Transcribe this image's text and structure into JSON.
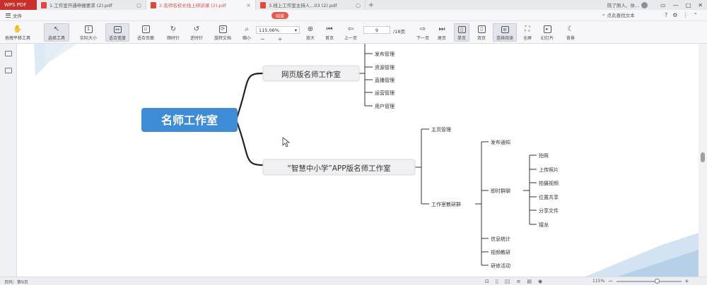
{
  "titlebar": {
    "app_name": "WPS PDF",
    "tabs": [
      {
        "label": "1.工作室开通申报要求 (2).pdf",
        "active": false
      },
      {
        "label": "2.名师名校长线上研训课 (2).pdf",
        "active": true
      },
      {
        "label": "3.线上工作室主持人...03 (2).pdf",
        "active": false
      }
    ],
    "new_tab": "+",
    "user_name": "陈了照人、休..."
  },
  "menu": {
    "file": "文件",
    "reading_badge": "阅读",
    "find_placeholder": "点此查找文本"
  },
  "toolbar": {
    "items": [
      {
        "label": "拖拽平移工具",
        "icon": "hand-icon"
      },
      {
        "label": "选择工具",
        "icon": "cursor-icon"
      },
      {
        "label": "实际大小",
        "icon": "actual-size-icon"
      },
      {
        "label": "适合宽度",
        "icon": "fit-width-icon"
      },
      {
        "label": "适合页面",
        "icon": "fit-page-icon"
      },
      {
        "label": "顺时针",
        "icon": "rotate-cw-icon"
      },
      {
        "label": "逆时针",
        "icon": "rotate-ccw-icon"
      },
      {
        "label": "旋转文档",
        "icon": "rotate-doc-icon"
      },
      {
        "label": "缩小",
        "icon": "zoom-out-icon"
      }
    ],
    "zoom_value": "115.06%",
    "zoom_in_label": "放大",
    "first_page": "首页",
    "prev_page": "上一页",
    "page_current": "9",
    "page_total": "/18页",
    "next_page": "下一页",
    "last_page": "尾页",
    "single_page": "单页",
    "double_page": "双页",
    "continuous": "连续阅读",
    "fullscreen": "全屏",
    "slideshow": "幻灯片",
    "background": "背景"
  },
  "mindmap": {
    "root": "名师工作室",
    "web_branch": "网页版名师工作室",
    "web_items": [
      "发布管理",
      "资源管理",
      "直播管理",
      "运营管理",
      "用户管理"
    ],
    "app_branch": "“智慧中小学”APP版名师工作室",
    "app_items": [
      "主页管理",
      "工作室教研群"
    ],
    "group_items": [
      "发布通知",
      "即时群聊",
      "信息统计",
      "视频教研",
      "研修活动"
    ],
    "chat_items": [
      "拍照",
      "上传照片",
      "拍摄视频",
      "位置共享",
      "分享文件",
      "接龙"
    ]
  },
  "status": {
    "page_info": "页码：第9页",
    "zoom": "115%"
  }
}
